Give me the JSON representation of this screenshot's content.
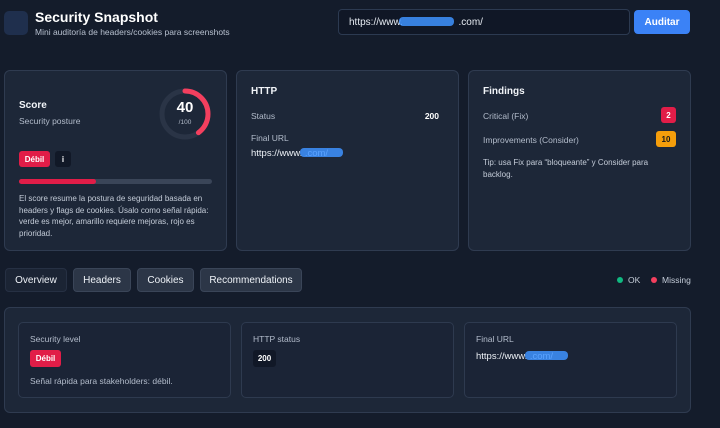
{
  "header": {
    "title": "Security Snapshot",
    "subtitle": "Mini auditoría de headers/cookies para screenshots",
    "url_value": "https://www.                    .com/",
    "audit_label": "Auditar"
  },
  "score_card": {
    "title": "Score",
    "subtitle": "Security posture",
    "score": "40",
    "score_max": "/100",
    "score_fraction": 0.4,
    "level_badge": "Débil",
    "info_badge": "i",
    "description": "El score resume la postura de seguridad basada en headers y flags de cookies. Úsalo como señal rápida: verde es mejor, amarillo requiere mejoras, rojo es prioridad."
  },
  "http_card": {
    "title": "HTTP",
    "status_label": "Status",
    "status_value": "200",
    "final_url_label": "Final URL",
    "final_url_value": "https://www.              .com/"
  },
  "findings_card": {
    "title": "Findings",
    "critical_label": "Critical (Fix)",
    "critical_count": "2",
    "improvements_label": "Improvements (Consider)",
    "improvements_count": "10",
    "tip": "Tip: usa Fix para “bloqueante” y Consider para backlog."
  },
  "tabs": [
    "Overview",
    "Headers",
    "Cookies",
    "Recommendations"
  ],
  "legend": {
    "ok": "OK",
    "missing": "Missing"
  },
  "overview": {
    "security_level_label": "Security level",
    "security_level_badge": "Débil",
    "security_level_note": "Señal rápida para stakeholders: débil.",
    "http_status_label": "HTTP status",
    "http_status_badge": "200",
    "final_url_label": "Final URL",
    "final_url_value": "https://www.              .com/"
  },
  "colors": {
    "accent": "#3b82f6",
    "danger": "#e11d48",
    "warning": "#f59e0b",
    "ok": "#10b981"
  }
}
